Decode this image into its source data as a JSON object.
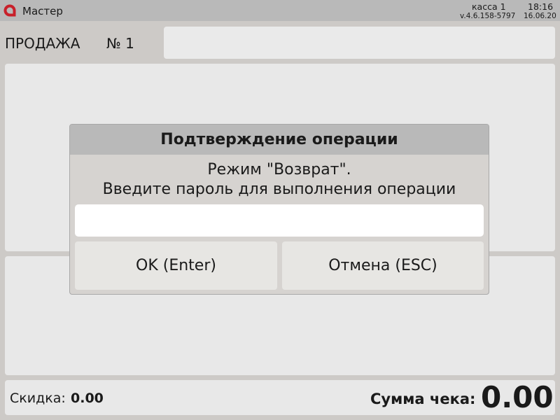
{
  "header": {
    "logo_icon": "red-circle-logo-icon",
    "accent_color": "#c8202a",
    "user": "Мастер",
    "register": "касса 1",
    "time": "18:16",
    "version": "v.4.6.158-5797",
    "date": "16.06.20"
  },
  "sale": {
    "label": "ПРОДАЖА",
    "number": "№ 1"
  },
  "footer": {
    "discount_label": "Скидка:",
    "discount_value": "0.00",
    "total_label": "Сумма чека:",
    "total_value": "0.00"
  },
  "dialog": {
    "title": "Подтверждение операции",
    "message_line1": "Режим \"Возврат\".",
    "message_line2": "Введите пароль для выполнения операции",
    "password_value": "",
    "ok_label": "OK (Enter)",
    "cancel_label": "Отмена (ESC)"
  }
}
